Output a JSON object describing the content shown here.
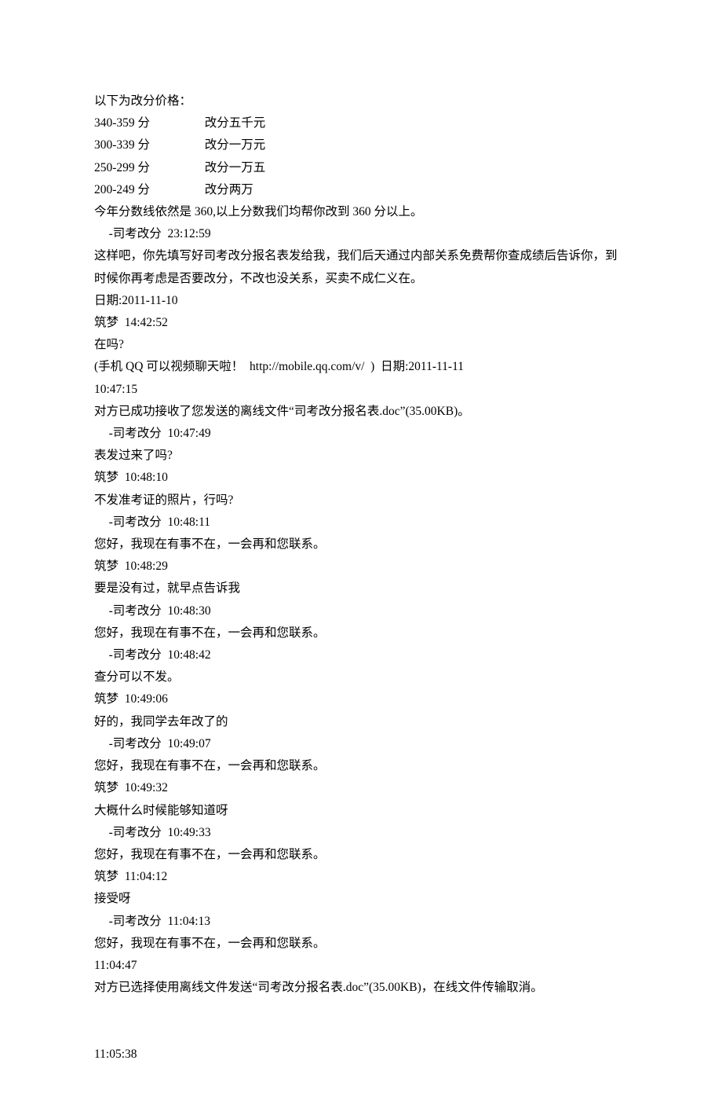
{
  "l0": "以下为改分价格：",
  "l1": "340-359 分                  改分五千元",
  "l2": "300-339 分                  改分一万元",
  "l3": "250-299 分                  改分一万五",
  "l4": "200-249 分                  改分两万",
  "l5": "今年分数线依然是 360,以上分数我们均帮你改到 360 分以上。",
  "l6": "-司考改分  23:12:59",
  "l7": "这样吧，你先填写好司考改分报名表发给我，我们后天通过内部关系免费帮你查成绩后告诉你，到时候你再考虑是否要改分，不改也没关系，买卖不成仁义在。",
  "l8": "日期:2011-11-10",
  "l9": "筑梦  14:42:52",
  "l10": "在吗?",
  "l11": "(手机 QQ 可以视频聊天啦！  http://mobile.qq.com/v/  )  日期:2011-11-11",
  "l12": "10:47:15",
  "l13": "对方已成功接收了您发送的离线文件“司考改分报名表.doc”(35.00KB)。",
  "l14": "-司考改分  10:47:49",
  "l15": "表发过来了吗?",
  "l16": "筑梦  10:48:10",
  "l17": "不发准考证的照片，行吗?",
  "l18": "-司考改分  10:48:11",
  "l19": "您好，我现在有事不在，一会再和您联系。",
  "l20": "筑梦  10:48:29",
  "l21": "要是没有过，就早点告诉我",
  "l22": "-司考改分  10:48:30",
  "l23": "您好，我现在有事不在，一会再和您联系。",
  "l24": "-司考改分  10:48:42",
  "l25": "查分可以不发。",
  "l26": "筑梦  10:49:06",
  "l27": "好的，我同学去年改了的",
  "l28": "-司考改分  10:49:07",
  "l29": "您好，我现在有事不在，一会再和您联系。",
  "l30": "筑梦  10:49:32",
  "l31": "大概什么时候能够知道呀",
  "l32": "-司考改分  10:49:33",
  "l33": "您好，我现在有事不在，一会再和您联系。",
  "l34": "筑梦  11:04:12",
  "l35": "接受呀",
  "l36": "-司考改分  11:04:13",
  "l37": "您好，我现在有事不在，一会再和您联系。",
  "l38": "11:04:47",
  "l39": "对方已选择使用离线文件发送“司考改分报名表.doc”(35.00KB)，在线文件传输取消。",
  "l40": "11:05:38"
}
